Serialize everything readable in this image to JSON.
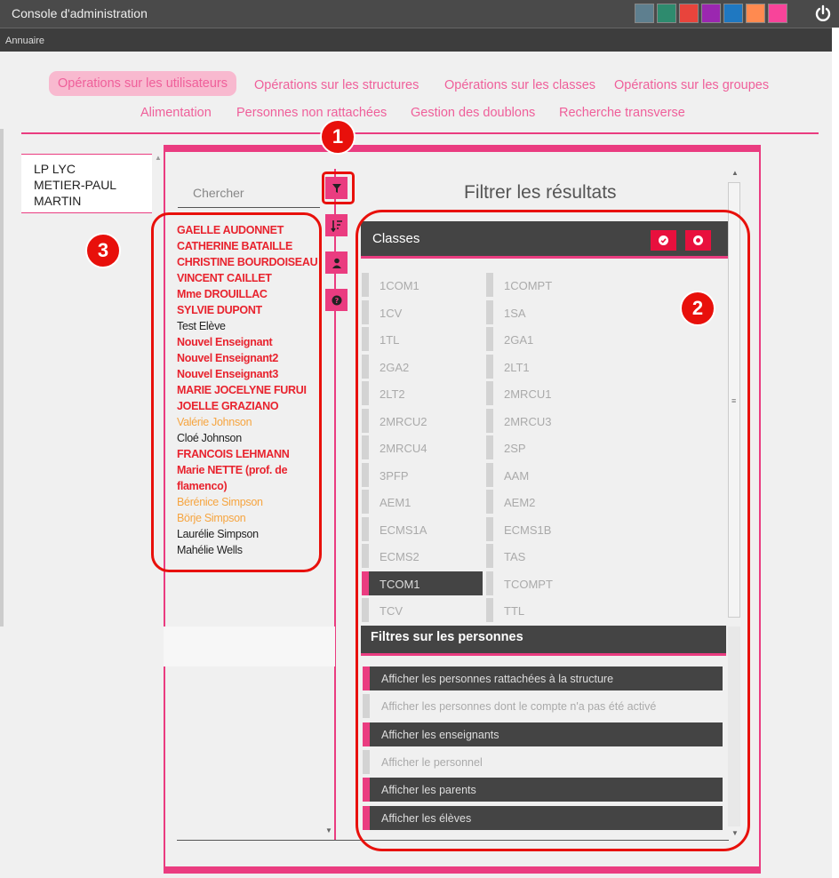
{
  "app": {
    "title": "Console d'administration",
    "subnav": "Annuaire",
    "theme_colors": [
      "#5e7f8f",
      "#2e8b6e",
      "#e8443c",
      "#9b27b0",
      "#1f78c1",
      "#ff8a50",
      "#f8449a"
    ]
  },
  "nav": {
    "row1": [
      "Opérations sur les utilisateurs",
      "Opérations sur les structures",
      "Opérations sur les classes",
      "Opérations sur les groupes"
    ],
    "row2": [
      "Alimentation",
      "Personnes non rattachées",
      "Gestion des doublons",
      "Recherche transverse"
    ],
    "active": "Opérations sur les utilisateurs"
  },
  "structure": {
    "lines": [
      "LP LYC",
      "METIER-PAUL",
      "MARTIN"
    ]
  },
  "search": {
    "placeholder": "Chercher"
  },
  "users": [
    {
      "name": "GAELLE AUDONNET",
      "style": "red"
    },
    {
      "name": "CATHERINE BATAILLE",
      "style": "red"
    },
    {
      "name": "CHRISTINE BOURDOISEAU",
      "style": "red"
    },
    {
      "name": "VINCENT CAILLET",
      "style": "red"
    },
    {
      "name": "Mme DROUILLAC",
      "style": "red"
    },
    {
      "name": "SYLVIE DUPONT",
      "style": "red"
    },
    {
      "name": "Test Elève",
      "style": "black"
    },
    {
      "name": "Nouvel Enseignant",
      "style": "red"
    },
    {
      "name": "Nouvel Enseignant2",
      "style": "red"
    },
    {
      "name": "Nouvel Enseignant3",
      "style": "red"
    },
    {
      "name": "MARIE JOCELYNE FURUI",
      "style": "red"
    },
    {
      "name": "JOELLE GRAZIANO",
      "style": "red"
    },
    {
      "name": "Valérie Johnson",
      "style": "orange"
    },
    {
      "name": "Cloé Johnson",
      "style": "black"
    },
    {
      "name": "FRANCOIS LEHMANN",
      "style": "red"
    },
    {
      "name": "Marie NETTE (prof. de",
      "style": "red"
    },
    {
      "name": "flamenco)",
      "style": "red"
    },
    {
      "name": "Bérénice Simpson",
      "style": "orange"
    },
    {
      "name": "Börje Simpson",
      "style": "orange"
    },
    {
      "name": "Laurélie Simpson",
      "style": "black"
    },
    {
      "name": "Mahélie Wells",
      "style": "black"
    }
  ],
  "filter": {
    "title": "Filtrer les résultats",
    "classes_header": "Classes",
    "classes_col1": [
      "1COM1",
      "1CV",
      "1TL",
      "2GA2",
      "2LT2",
      "2MRCU2",
      "2MRCU4",
      "3PFP",
      "AEM1",
      "ECMS1A",
      "ECMS2",
      "TCOM1",
      "TCV"
    ],
    "classes_col2": [
      "1COMPT",
      "1SA",
      "2GA1",
      "2LT1",
      "2MRCU1",
      "2MRCU3",
      "2SP",
      "AAM",
      "AEM2",
      "ECMS1B",
      "TAS",
      "TCOMPT",
      "TTL"
    ],
    "selected_class": "TCOM1",
    "persons_header": "Filtres sur les personnes",
    "person_filters": [
      {
        "label": "Afficher les personnes rattachées à la structure",
        "active": true
      },
      {
        "label": "Afficher les personnes dont le compte n'a pas été activé",
        "active": false
      },
      {
        "label": "Afficher les enseignants",
        "active": true
      },
      {
        "label": "Afficher le personnel",
        "active": false
      },
      {
        "label": "Afficher les parents",
        "active": true
      },
      {
        "label": "Afficher les élèves",
        "active": true
      }
    ]
  },
  "annotations": {
    "badge1": "1",
    "badge2": "2",
    "badge3": "3"
  }
}
